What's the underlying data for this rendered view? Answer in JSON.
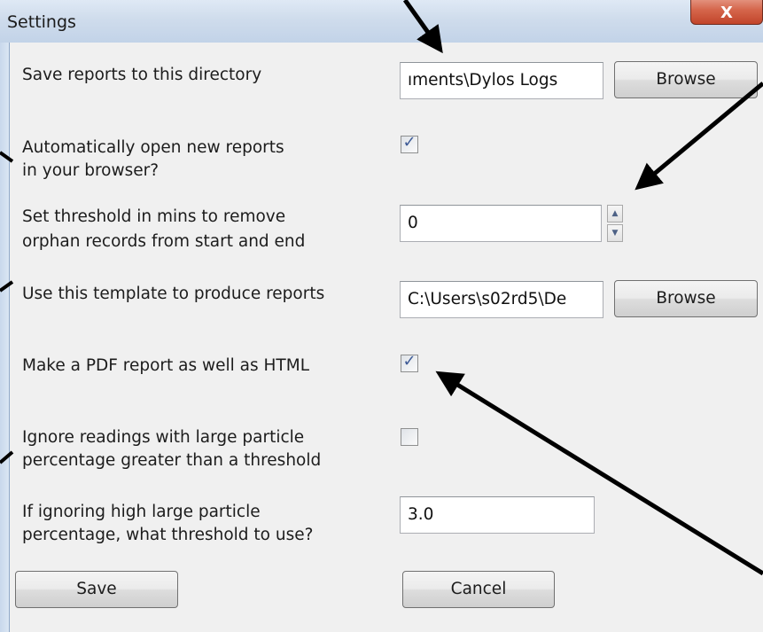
{
  "window": {
    "title": "Settings",
    "close_label": "X"
  },
  "form": {
    "save_dir": {
      "label": "Save reports to this directory",
      "value": "ıments\\Dylos Logs",
      "browse_label": "Browse"
    },
    "auto_open": {
      "label_line1": "Automatically open new reports",
      "label_line2": "in your browser?",
      "checked": true
    },
    "threshold_mins": {
      "label_line1": "Set threshold in mins to remove",
      "label_line2": " orphan records from start and end",
      "value": "0"
    },
    "template": {
      "label": "Use this template to produce reports",
      "value": "C:\\Users\\s02rd5\\De",
      "browse_label": "Browse"
    },
    "pdf_report": {
      "label": "Make a PDF report as well as HTML",
      "checked": true
    },
    "ignore_large": {
      "label_line1": "Ignore readings with large particle",
      "label_line2": "percentage greater than a threshold",
      "checked": false
    },
    "large_threshold": {
      "label_line1": "If ignoring high large particle",
      "label_line2": "percentage, what threshold to use?",
      "value": "3.0"
    }
  },
  "actions": {
    "save_label": "Save",
    "cancel_label": "Cancel"
  },
  "icons": {
    "check": "checkmark-icon",
    "spin_up": "up-arrow-icon",
    "spin_down": "down-arrow-icon"
  },
  "colors": {
    "titlebar": "#cfdcec",
    "close_button": "#d5664c",
    "client_bg": "#f0f0f0",
    "checkmark": "#3d5a96"
  }
}
